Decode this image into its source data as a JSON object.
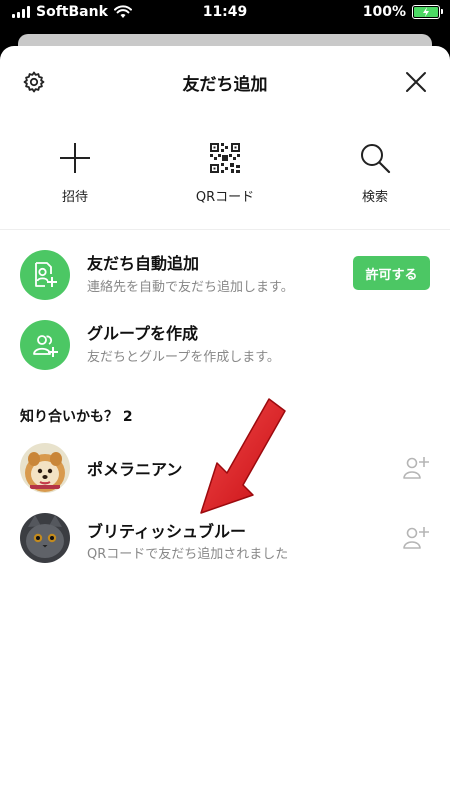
{
  "status_bar": {
    "carrier": "SoftBank",
    "time": "11:49",
    "battery": "100%"
  },
  "header": {
    "title": "友だち追加"
  },
  "actions": [
    {
      "label": "招待",
      "icon": "plus-icon"
    },
    {
      "label": "QRコード",
      "icon": "qr-code-icon"
    },
    {
      "label": "検索",
      "icon": "search-icon"
    }
  ],
  "auto_add": {
    "title": "友だち自動追加",
    "description": "連絡先を自動で友だち追加します。",
    "button": "許可する"
  },
  "create_group": {
    "title": "グループを作成",
    "description": "友だちとグループを作成します。"
  },
  "suggestions": {
    "heading": "知り合いかも？ 2",
    "items": [
      {
        "name": "ポメラニアン",
        "subtitle": ""
      },
      {
        "name": "ブリティッシュブルー",
        "subtitle": "QRコードで友だち追加されました"
      }
    ]
  },
  "colors": {
    "accent": "#4cc764",
    "arrow": "#e8141c"
  }
}
